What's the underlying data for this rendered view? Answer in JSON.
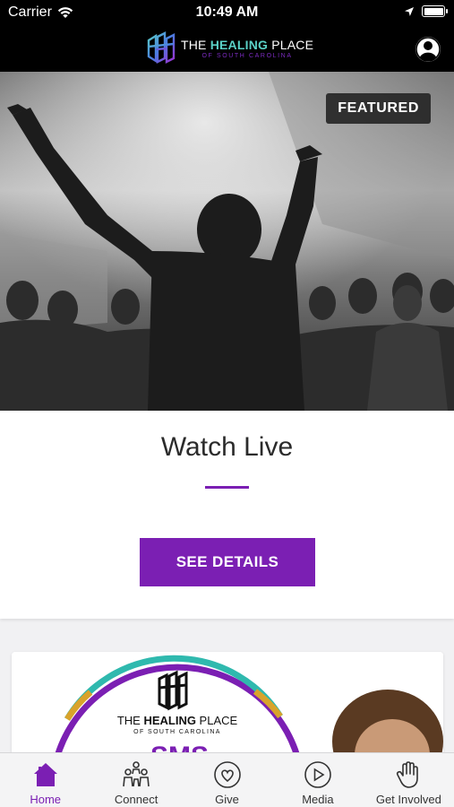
{
  "status_bar": {
    "carrier": "Carrier",
    "time": "10:49 AM",
    "icons": [
      "wifi-icon",
      "location-arrow-icon",
      "battery-icon"
    ]
  },
  "nav": {
    "logo_line1_prefix": "THE ",
    "logo_line1_bold": "HEALING",
    "logo_line1_suffix": " PLACE",
    "logo_line2": "OF SOUTH CAROLINA",
    "profile_icon": "user-profile-icon"
  },
  "hero": {
    "badge": "FEATURED",
    "image": "worship-crowd-photo"
  },
  "card": {
    "title": "Watch Live",
    "button": "SEE DETAILS"
  },
  "promo": {
    "logo_line1_prefix": "THE ",
    "logo_line1_bold": "HEALING",
    "logo_line1_suffix": " PLACE",
    "logo_line2": "OF SOUTH CAROLINA",
    "partial_text": "SMS"
  },
  "tabs": [
    {
      "label": "Home",
      "icon": "home-icon",
      "active": true
    },
    {
      "label": "Connect",
      "icon": "people-icon",
      "active": false
    },
    {
      "label": "Give",
      "icon": "heart-circle-icon",
      "active": false
    },
    {
      "label": "Media",
      "icon": "play-circle-icon",
      "active": false
    },
    {
      "label": "Get Involved",
      "icon": "raised-hand-icon",
      "active": false
    }
  ],
  "colors": {
    "accent": "#7b1fb3",
    "nav_bg": "#000000",
    "teal": "#2fb9ae",
    "gold": "#d9a32b"
  }
}
